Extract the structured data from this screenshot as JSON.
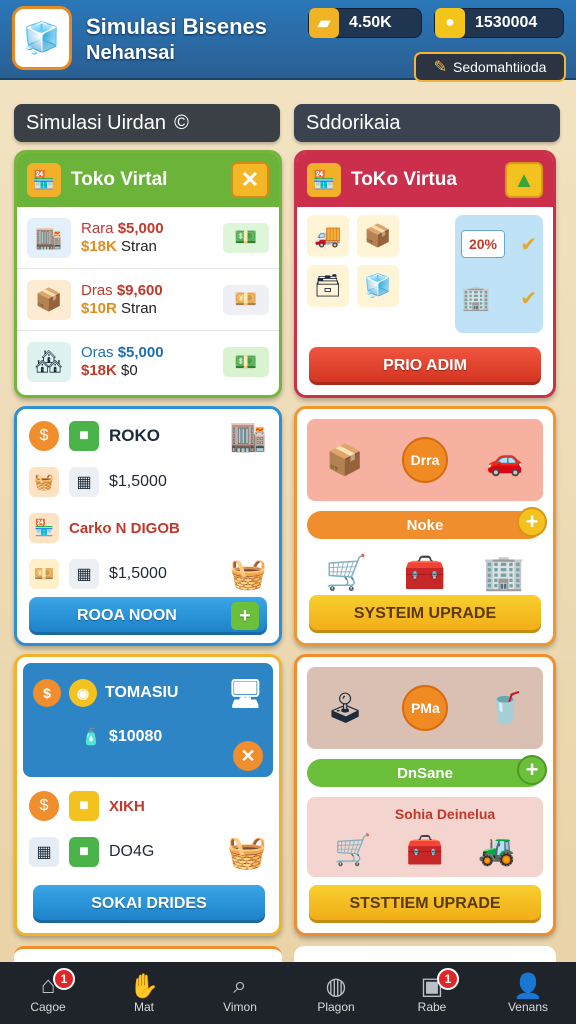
{
  "header": {
    "logo_icon": "box-cube-icon",
    "title": "Simulasi Bisenes",
    "subtitle": "Nehansai",
    "currency_1": {
      "icon": "gold-bars-icon",
      "value": "4.50K"
    },
    "currency_2": {
      "icon": "coin-icon",
      "value": "1530004"
    },
    "settings_label": "Sedomahtiioda",
    "settings_icon": "pencil-icon"
  },
  "sections": {
    "left_title": "Simulasi Uirdan",
    "left_icon": "©",
    "right_title": "Sddorikaia"
  },
  "card_a": {
    "title": "Toko Virtal",
    "rows": [
      {
        "line1a": "Rara",
        "line1b": "$5,000",
        "line2a": "$18K",
        "line2b": "Stran"
      },
      {
        "line1a": "Dras",
        "line1b": "$9,600",
        "line2a": "$10R",
        "line2b": "Stran"
      },
      {
        "line1a": "Oras",
        "line1b": "$5,000",
        "line2a": "$18K",
        "line2b": "$0"
      }
    ]
  },
  "card_b": {
    "title": "ToKo Virtua",
    "pct_label": "20%",
    "button": "PRIO ADIM"
  },
  "card_c": {
    "row1": "ROKO",
    "row2": "$1,5000",
    "row3": "Carko N DIGOB",
    "row4": "$1,5000",
    "button": "ROOA NOON",
    "button_plus": "+"
  },
  "card_d": {
    "coin_label": "Drra",
    "pill": "Noke",
    "plus": "+",
    "button": "SYSTEIM UPRADE"
  },
  "card_e": {
    "title": "TOMASIU",
    "amount": "$10080",
    "row1": "XIKH",
    "row2": "DO4G",
    "button": "SOKAI DRIDES"
  },
  "card_f": {
    "coin_label": "PMa",
    "pill": "DnSane",
    "plus": "+",
    "shop_label": "Sohia Deinelua",
    "button": "STSTTIEM UPRADE"
  },
  "nav": [
    {
      "icon": "home-icon",
      "label": "Cagoe",
      "badge": "1"
    },
    {
      "icon": "hand-icon",
      "label": "Mat",
      "badge": ""
    },
    {
      "icon": "search-icon",
      "label": "Vimon",
      "badge": ""
    },
    {
      "icon": "profile-icon",
      "label": "Plagon",
      "badge": ""
    },
    {
      "icon": "shop-icon",
      "label": "Rabe",
      "badge": "1"
    },
    {
      "icon": "user-icon",
      "label": "Venans",
      "badge": ""
    }
  ]
}
